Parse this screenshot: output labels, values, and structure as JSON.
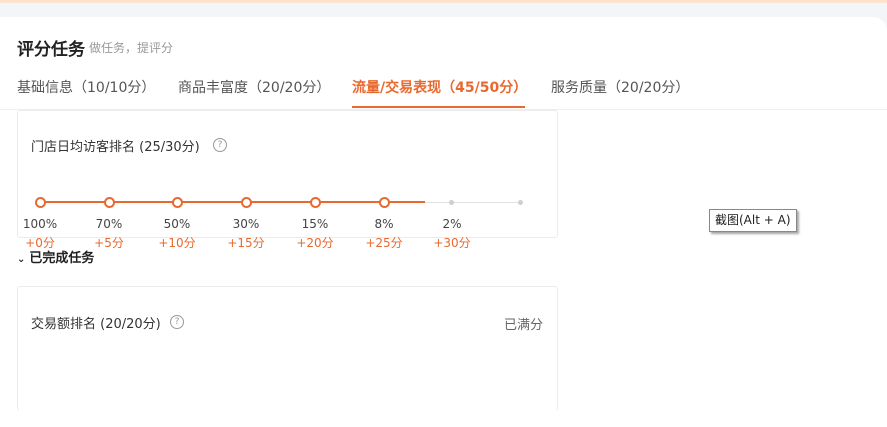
{
  "header": {
    "title": "评分任务",
    "subtitle": "做任务，提评分"
  },
  "tabs": [
    {
      "label": "基础信息（10/10分）"
    },
    {
      "label": "商品丰富度（20/20分）"
    },
    {
      "label": "流量/交易表现（45/50分）",
      "active": true
    },
    {
      "label": "服务质量（20/20分）"
    }
  ],
  "task1": {
    "title": "门店日均访客排名 (25/30分)",
    "progress_steps_reached": 6,
    "steps": [
      {
        "pct": "100%",
        "pts": "+0分"
      },
      {
        "pct": "70%",
        "pts": "+5分"
      },
      {
        "pct": "50%",
        "pts": "+10分"
      },
      {
        "pct": "30%",
        "pts": "+15分"
      },
      {
        "pct": "15%",
        "pts": "+20分"
      },
      {
        "pct": "8%",
        "pts": "+25分"
      },
      {
        "pct": "2%",
        "pts": "+30分"
      }
    ]
  },
  "completed_section": {
    "label": "已完成任务"
  },
  "task2": {
    "title": "交易额排名 (20/20分)",
    "status": "已满分"
  },
  "tooltip": {
    "text": "截图(Alt + A)"
  },
  "colors": {
    "accent": "#e8692f",
    "inactive": "#cfcfcf"
  },
  "icons": {
    "help": "question-circle-icon",
    "toggle": "chevron-down-icon"
  }
}
